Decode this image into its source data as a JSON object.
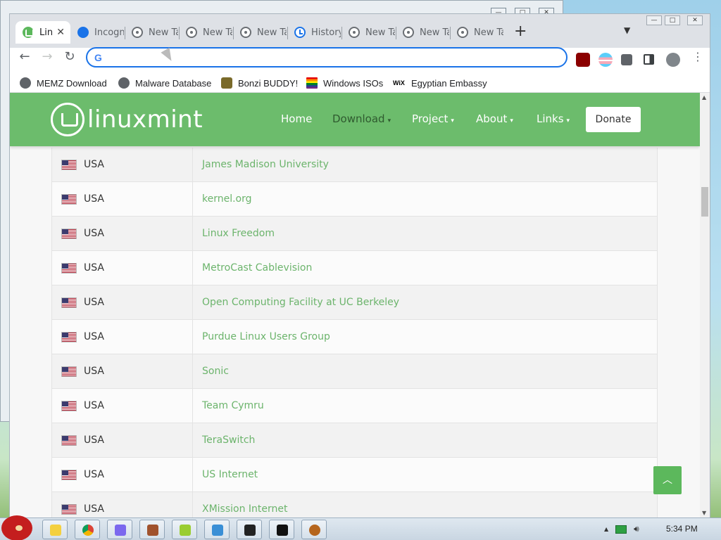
{
  "browser": {
    "tabs": [
      {
        "label": "Linux Mint",
        "icon": "linuxmint-icon",
        "active": true
      },
      {
        "label": "Incognito",
        "icon": "incognito-icon"
      },
      {
        "label": "New Tab",
        "icon": "chrome-icon"
      },
      {
        "label": "New Tab",
        "icon": "chrome-icon"
      },
      {
        "label": "New Tab",
        "icon": "chrome-icon"
      },
      {
        "label": "History",
        "icon": "history-icon"
      },
      {
        "label": "New Tab",
        "icon": "chrome-icon"
      },
      {
        "label": "New Tab",
        "icon": "chrome-icon"
      },
      {
        "label": "New Tab",
        "icon": "chrome-icon"
      }
    ],
    "new_tab_glyph": "+",
    "address": {
      "value": "",
      "badge": "G"
    },
    "bookmarks": [
      {
        "label": "MEMZ Download",
        "icon": "globe-icon"
      },
      {
        "label": "Malware Database",
        "icon": "globe-icon"
      },
      {
        "label": "Bonzi BUDDY!",
        "icon": "bonzi-icon"
      },
      {
        "label": "Windows ISOs",
        "icon": "rainbow-flag-icon"
      },
      {
        "label": "Egyptian Embassy",
        "icon": "wix-icon"
      }
    ],
    "wix_glyph": "WiX"
  },
  "site": {
    "logo_text": "linuxmint",
    "nav": [
      {
        "label": "Home",
        "dropdown": false
      },
      {
        "label": "Download",
        "dropdown": true
      },
      {
        "label": "Project",
        "dropdown": true
      },
      {
        "label": "About",
        "dropdown": true
      },
      {
        "label": "Links",
        "dropdown": true
      }
    ],
    "donate_label": "Donate",
    "mirrors": [
      {
        "country": "USA",
        "name": "James Madison University"
      },
      {
        "country": "USA",
        "name": "kernel.org"
      },
      {
        "country": "USA",
        "name": "Linux Freedom"
      },
      {
        "country": "USA",
        "name": "MetroCast Cablevision"
      },
      {
        "country": "USA",
        "name": "Open Computing Facility at UC Berkeley"
      },
      {
        "country": "USA",
        "name": "Purdue Linux Users Group"
      },
      {
        "country": "USA",
        "name": "Sonic"
      },
      {
        "country": "USA",
        "name": "Team Cymru"
      },
      {
        "country": "USA",
        "name": "TeraSwitch"
      },
      {
        "country": "USA",
        "name": "US Internet"
      },
      {
        "country": "USA",
        "name": "XMission Internet"
      }
    ],
    "accent": "#6cbc6c"
  },
  "taskbar": {
    "clock": "5:34 PM",
    "apps": [
      "paint-icon",
      "chrome-icon",
      "control-panel-icon",
      "tools-icon",
      "files-icon",
      "media-player-icon",
      "7zip-icon",
      "terminal-icon",
      "browser-icon"
    ]
  }
}
